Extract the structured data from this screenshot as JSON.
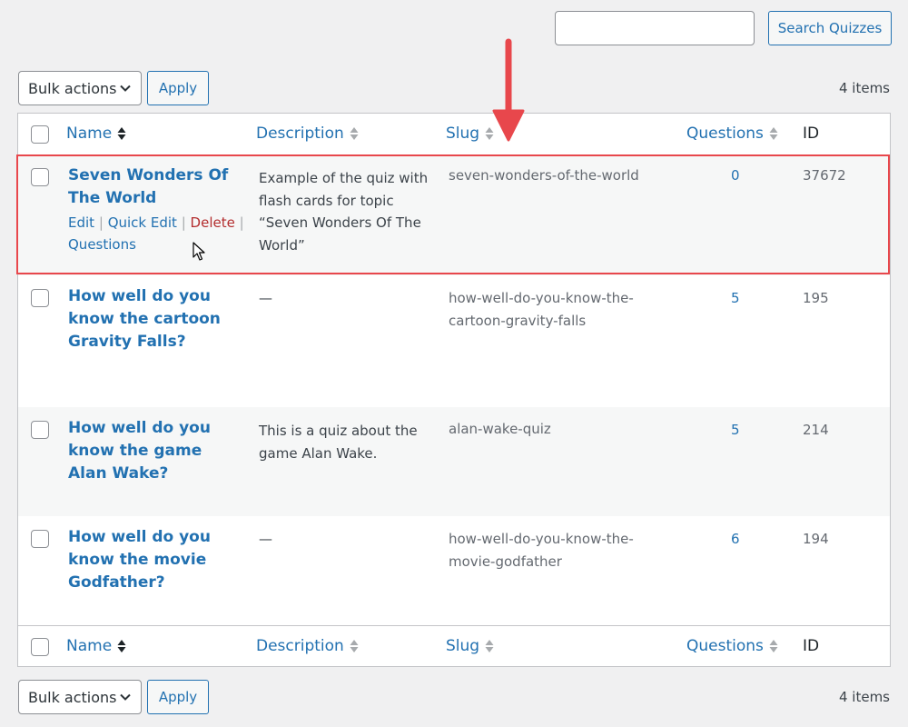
{
  "search": {
    "placeholder": "",
    "button_label": "Search Quizzes"
  },
  "bulk_actions": {
    "selected": "Bulk actions",
    "apply_label": "Apply"
  },
  "item_count": "4 items",
  "columns": {
    "name": "Name",
    "description": "Description",
    "slug": "Slug",
    "questions": "Questions",
    "id": "ID"
  },
  "rows": [
    {
      "title": "Seven Wonders Of The World",
      "description": "Example of the quiz with flash cards for topic “Seven Wonders Of The World”",
      "slug": "seven-wonders-of-the-world",
      "questions": "0",
      "id": "37672",
      "actions": {
        "edit": "Edit",
        "quick_edit": "Quick Edit",
        "delete": "Delete",
        "questions": "Questions",
        "sep": "|"
      }
    },
    {
      "title": "How well do you know the cartoon Gravity Falls?",
      "description": "—",
      "slug": "how-well-do-you-know-the-cartoon-gravity-falls",
      "questions": "5",
      "id": "195"
    },
    {
      "title": "How well do you know the game Alan Wake?",
      "description": "This is a quiz about the game Alan Wake.",
      "slug": "alan-wake-quiz",
      "questions": "5",
      "id": "214"
    },
    {
      "title": "How well do you know the movie Godfather?",
      "description": "—",
      "slug": "how-well-do-you-know-the-movie-godfather",
      "questions": "6",
      "id": "194"
    }
  ],
  "icons": {
    "sort": "sort-arrows-icon",
    "chevron": "chevron-down-icon",
    "arrow": "red-arrow-annotation",
    "cursor": "mouse-pointer-icon"
  },
  "colors": {
    "link": "#2271b1",
    "delete": "#b32d2e",
    "highlight": "#e8474c"
  }
}
